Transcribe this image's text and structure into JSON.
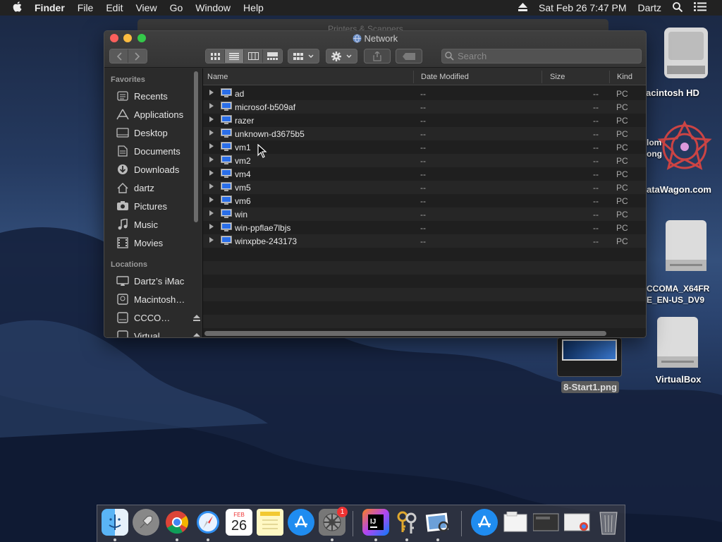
{
  "menubar": {
    "app": "Finder",
    "items": [
      "File",
      "Edit",
      "View",
      "Go",
      "Window",
      "Help"
    ],
    "datetime": "Sat Feb 26  7:47 PM",
    "user": "Dartz"
  },
  "background_window": {
    "title": "Printers & Scanners"
  },
  "window": {
    "title": "Network",
    "search_placeholder": "Search"
  },
  "sidebar": {
    "favorites_header": "Favorites",
    "favorites": [
      {
        "label": "Recents",
        "icon": "recents-icon"
      },
      {
        "label": "Applications",
        "icon": "applications-icon"
      },
      {
        "label": "Desktop",
        "icon": "desktop-icon"
      },
      {
        "label": "Documents",
        "icon": "documents-icon"
      },
      {
        "label": "Downloads",
        "icon": "downloads-icon"
      },
      {
        "label": "dartz",
        "icon": "home-icon"
      },
      {
        "label": "Pictures",
        "icon": "pictures-icon"
      },
      {
        "label": "Music",
        "icon": "music-icon"
      },
      {
        "label": "Movies",
        "icon": "movies-icon"
      }
    ],
    "locations_header": "Locations",
    "locations": [
      {
        "label": "Dartz’s iMac",
        "icon": "imac-icon"
      },
      {
        "label": "Macintosh…",
        "icon": "hard-drive-icon"
      },
      {
        "label": "CCCO…",
        "icon": "disk-icon"
      },
      {
        "label": "Virtual…",
        "icon": "disk-icon"
      }
    ]
  },
  "list": {
    "columns": [
      "Name",
      "Date Modified",
      "Size",
      "Kind"
    ],
    "rows": [
      {
        "name": "ad",
        "date": "--",
        "size": "--",
        "kind": "PC"
      },
      {
        "name": "microsof-b509af",
        "date": "--",
        "size": "--",
        "kind": "PC"
      },
      {
        "name": "razer",
        "date": "--",
        "size": "--",
        "kind": "PC"
      },
      {
        "name": "unknown-d3675b5",
        "date": "--",
        "size": "--",
        "kind": "PC"
      },
      {
        "name": "vm1",
        "date": "--",
        "size": "--",
        "kind": "PC"
      },
      {
        "name": "vm2",
        "date": "--",
        "size": "--",
        "kind": "PC"
      },
      {
        "name": "vm4",
        "date": "--",
        "size": "--",
        "kind": "PC"
      },
      {
        "name": "vm5",
        "date": "--",
        "size": "--",
        "kind": "PC"
      },
      {
        "name": "vm6",
        "date": "--",
        "size": "--",
        "kind": "PC"
      },
      {
        "name": "win",
        "date": "--",
        "size": "--",
        "kind": "PC"
      },
      {
        "name": "win-ppflae7lbjs",
        "date": "--",
        "size": "--",
        "kind": "PC"
      },
      {
        "name": "winxpbe-243173",
        "date": "--",
        "size": "--",
        "kind": "PC"
      }
    ]
  },
  "desktop": {
    "icons": [
      {
        "label": "acintosh HD"
      },
      {
        "label": "lom\nong"
      },
      {
        "label": "ataWagon.com"
      },
      {
        "label": "CCOMA_X64FR\nE_EN-US_DV9"
      },
      {
        "label": "VirtualBox"
      },
      {
        "label": "8-Start1.png"
      }
    ]
  },
  "dock": {
    "calendar_month": "FEB",
    "calendar_day": "26",
    "settings_badge": "1",
    "apps": [
      "finder",
      "launchpad",
      "chrome",
      "safari",
      "calendar",
      "notes",
      "app-store",
      "system-preferences",
      "intellij",
      "keychain",
      "preview",
      "app-store-downloads",
      "documents-stack",
      "screenshot-stack",
      "download-stack",
      "trash"
    ]
  },
  "colors": {
    "row_alt": "#262626",
    "accent": "#2a6ee8"
  }
}
